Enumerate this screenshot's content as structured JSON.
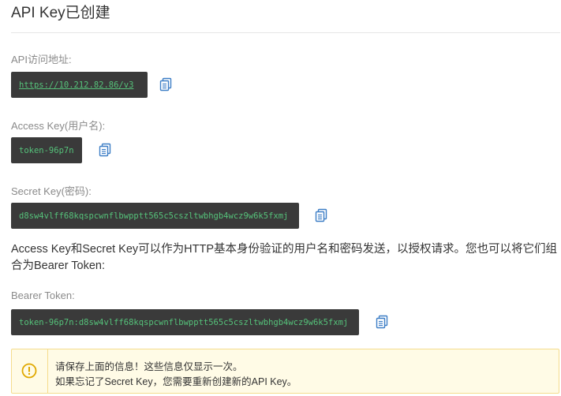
{
  "header": {
    "title": "API Key已创建"
  },
  "api_url": {
    "label": "API访问地址:",
    "value": "https://10.212.82.86/v3"
  },
  "access_key": {
    "label": "Access Key(用户名):",
    "value": "token-96p7n"
  },
  "secret_key": {
    "label": "Secret Key(密码):",
    "value": "d8sw4vlff68kqspcwnflbwpptt565c5cszltwbhgb4wcz9w6k5fxmj"
  },
  "description": "Access Key和Secret Key可以作为HTTP基本身份验证的用户名和密码发送，以授权请求。您也可以将它们组合为Bearer Token:",
  "bearer_token": {
    "label": "Bearer Token:",
    "value": "token-96p7n:d8sw4vlff68kqspcwnflbwpptt565c5cszltwbhgb4wcz9w6k5fxmj"
  },
  "notice": {
    "line1": "请保存上面的信息！这些信息仅显示一次。",
    "line2": "如果忘记了Secret Key，您需要重新创建新的API Key。"
  },
  "colors": {
    "code_bg": "#3a3a3a",
    "code_text": "#55c27a",
    "copy_icon": "#3d7ec6",
    "notice_bg": "#fffbe6",
    "notice_border": "#f5dc8c",
    "notice_icon": "#e0a800"
  },
  "icons": {
    "copy": "copy-icon",
    "warning": "info-circle-icon"
  }
}
